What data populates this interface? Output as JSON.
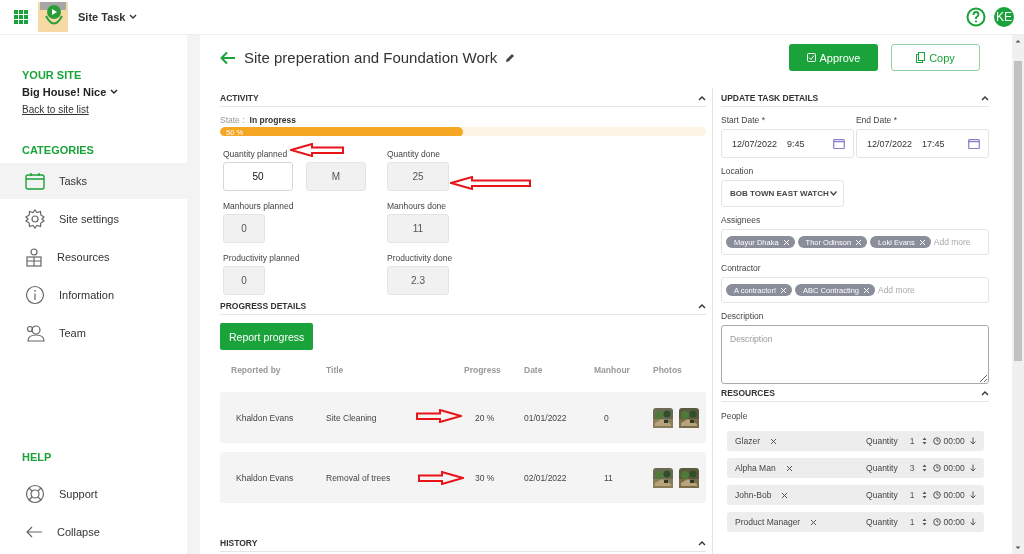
{
  "topbar": {
    "app_title": "Site Task",
    "avatar": "KE"
  },
  "sidebar": {
    "site_heading": "YOUR SITE",
    "site_name": "Big House! Nice",
    "back_link": "Back to site list",
    "categories_heading": "CATEGORIES",
    "items": [
      {
        "label": "Tasks",
        "kind": "calendar",
        "selected": true
      },
      {
        "label": "Site settings",
        "kind": "gear",
        "selected": false
      },
      {
        "label": "Resources",
        "kind": "boxes",
        "selected": false
      },
      {
        "label": "Information",
        "kind": "info",
        "selected": false
      },
      {
        "label": "Team",
        "kind": "team",
        "selected": false
      }
    ],
    "help_heading": "HELP",
    "help_items": [
      {
        "label": "Support",
        "kind": "lifebuoy"
      },
      {
        "label": "Collapse",
        "kind": "back"
      }
    ]
  },
  "page": {
    "title": "Site preperation and Foundation Work",
    "approve": "Approve",
    "copy": "Copy"
  },
  "activity": {
    "heading": "ACTIVITY",
    "state_label": "State :",
    "state": "In progress",
    "progress_label": "50 %",
    "level": 0.5,
    "fields": [
      {
        "label": "Quantity planned",
        "values": [
          {
            "text": "50",
            "disabled": false
          },
          {
            "text": "M",
            "disabled": true
          }
        ]
      },
      {
        "label": "Quantity done",
        "values": [
          {
            "text": "25",
            "disabled": true
          }
        ]
      },
      {
        "label": "Manhours planned",
        "values": [
          {
            "text": "0",
            "disabled": true
          }
        ]
      },
      {
        "label": "Manhours done",
        "values": [
          {
            "text": "11",
            "disabled": true
          }
        ]
      },
      {
        "label": "Productivity planned",
        "values": [
          {
            "text": "0",
            "disabled": true
          }
        ]
      },
      {
        "label": "Productivity done",
        "values": [
          {
            "text": "2.3",
            "disabled": true
          }
        ]
      }
    ]
  },
  "progress_details": {
    "heading": "PROGRESS DETAILS",
    "button": "Report progress",
    "columns": [
      "Reported by",
      "Title",
      "Progress",
      "Date",
      "Manhour",
      "Photos"
    ],
    "rows": [
      {
        "reported_by": "Khaldon Evans",
        "title": "Site Cleaning",
        "progress": "20 %",
        "date": "01/01/2022",
        "manhour": "0"
      },
      {
        "reported_by": "Khaldon Evans",
        "title": "Removal of trees",
        "progress": "30 %",
        "date": "02/01/2022",
        "manhour": "11"
      }
    ]
  },
  "history": {
    "heading": "HISTORY"
  },
  "task_details": {
    "heading": "UPDATE TASK DETAILS",
    "start": {
      "label": "Start Date *",
      "date": "12/07/2022",
      "time": "9:45"
    },
    "end": {
      "label": "End Date *",
      "date": "12/07/2022",
      "time": "17:45"
    },
    "location": {
      "label": "Location",
      "value": "BOB TOWN EAST WATCH"
    },
    "assignees": {
      "label": "Assignees",
      "chips": [
        "Mayur Dhaka",
        "Thor Odinson",
        "Loki Evans"
      ],
      "placeholder": "Add more"
    },
    "contractor": {
      "label": "Contractor",
      "chips": [
        "A contractor!",
        "ABC Contracting"
      ],
      "placeholder": "Add more"
    },
    "description": {
      "label": "Description",
      "placeholder": "Description"
    }
  },
  "resources": {
    "heading": "RESOURCES",
    "group": "People",
    "people": [
      {
        "name": "Glazer",
        "quantity_label": "Quantity",
        "quantity": "1",
        "time": "00:00"
      },
      {
        "name": "Alpha Man",
        "quantity_label": "Quantity",
        "quantity": "3",
        "time": "00:00"
      },
      {
        "name": "John-Bob",
        "quantity_label": "Quantity",
        "quantity": "1",
        "time": "00:00"
      },
      {
        "name": "Product Manager",
        "quantity_label": "Quantity",
        "quantity": "1",
        "time": "00:00"
      }
    ]
  }
}
